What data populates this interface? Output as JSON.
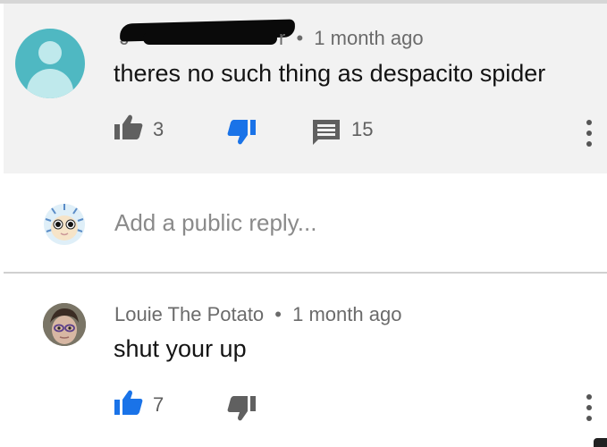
{
  "comment": {
    "author_visible_fragment": "J",
    "author_visible_tail": "r",
    "time_ago": "1 month ago",
    "text": "theres no such thing as despacito spider",
    "like_count": "3",
    "reply_count": "15",
    "dislike_color": "#1a73e8",
    "avatar_color": "#4fb8c2"
  },
  "reply_box": {
    "placeholder": "Add a public reply..."
  },
  "reply": {
    "author": "Louie The Potato",
    "time_ago": "1 month ago",
    "text": "shut your up",
    "like_count": "7",
    "like_color": "#1a73e8"
  },
  "separator": "•"
}
